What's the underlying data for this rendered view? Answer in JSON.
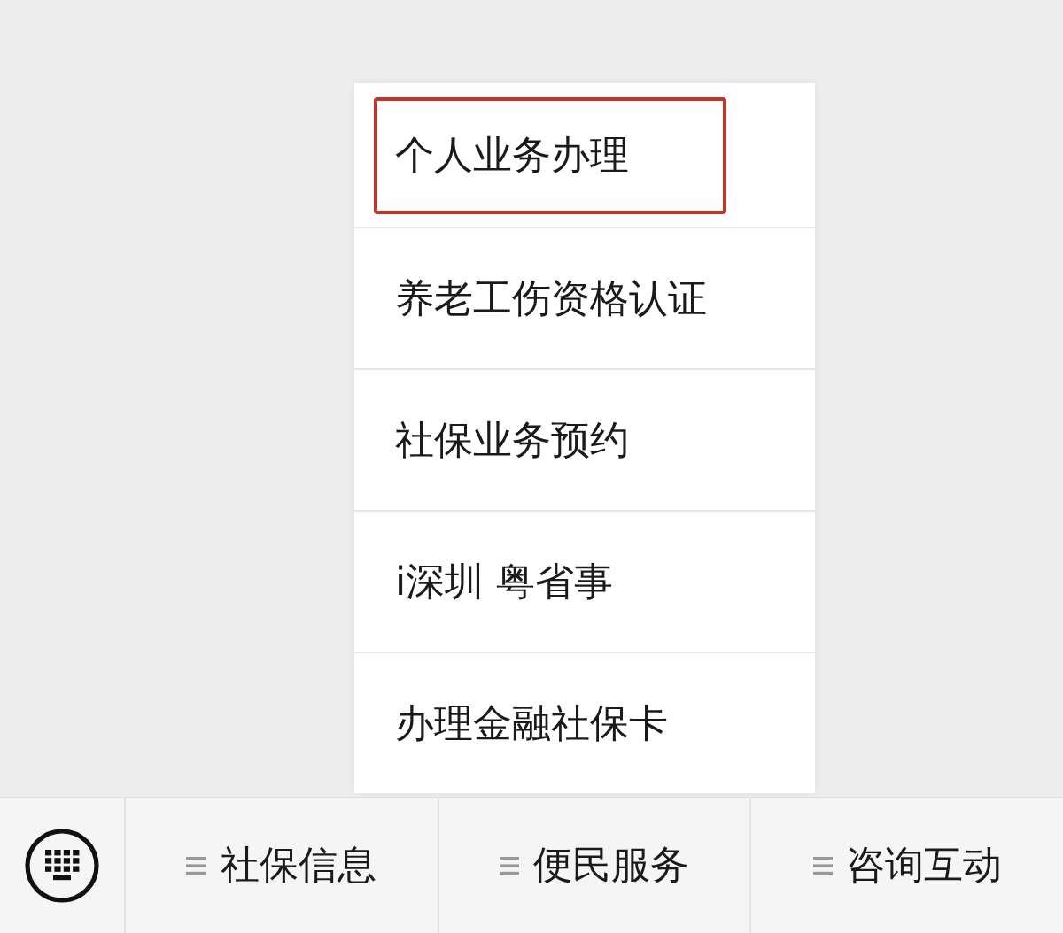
{
  "popup_menu": {
    "items": [
      {
        "label": "个人业务办理",
        "selected": true
      },
      {
        "label": "养老工伤资格认证",
        "selected": false
      },
      {
        "label": "社保业务预约",
        "selected": false
      },
      {
        "label": "i深圳 粤省事",
        "selected": false
      },
      {
        "label": "办理金融社保卡",
        "selected": false
      }
    ]
  },
  "bottom_menu": {
    "tabs": [
      {
        "label": "社保信息"
      },
      {
        "label": "便民服务"
      },
      {
        "label": "咨询互动"
      }
    ]
  }
}
